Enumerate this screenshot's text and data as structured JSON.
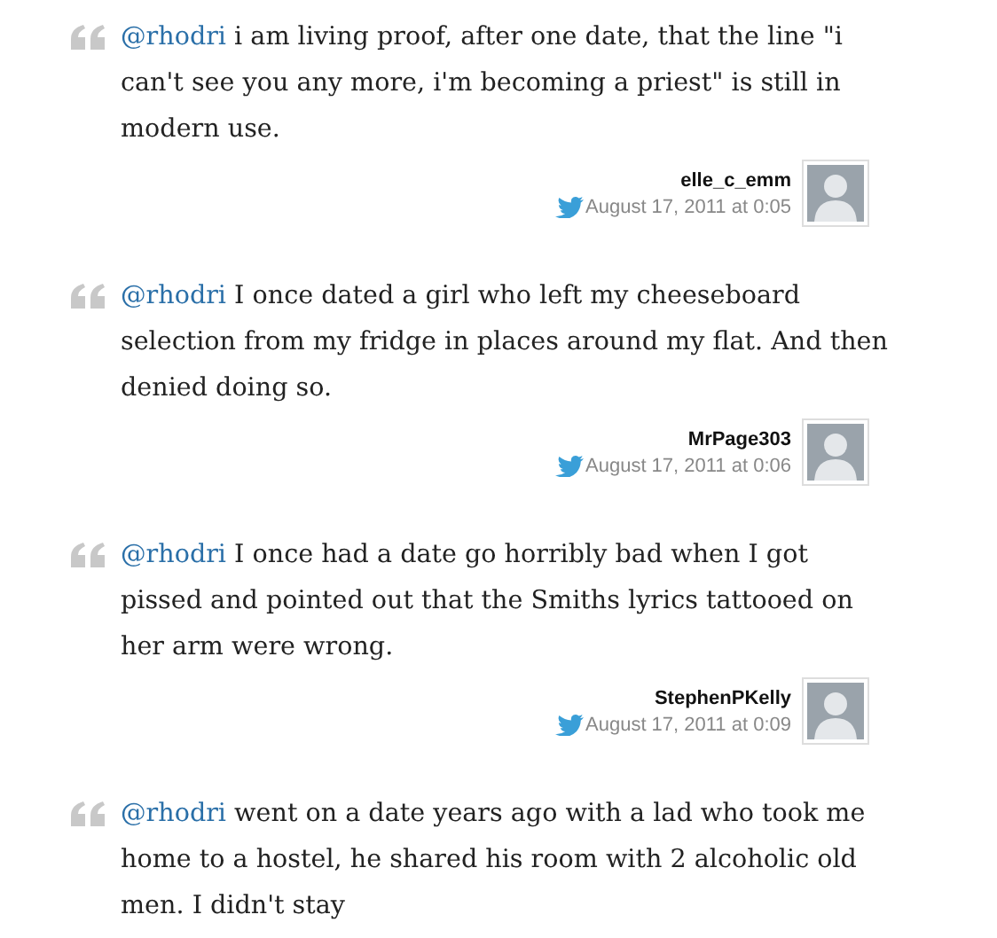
{
  "tweets": [
    {
      "mention": "@rhodri",
      "text": " i am living proof, after one date, that the line \"i can't see you any more, i'm becoming a priest\" is still in modern use.",
      "user": "elle_c_emm",
      "date": "August 17, 2011 at 0:05"
    },
    {
      "mention": "@rhodri",
      "text": " I once dated a girl who left my cheeseboard selection from my fridge in places around my flat. And then denied doing so.",
      "user": "MrPage303",
      "date": "August 17, 2011 at 0:06"
    },
    {
      "mention": "@rhodri",
      "text": " I once had a date go horribly bad when I got pissed and pointed out that the Smiths lyrics tattooed on her arm were wrong.",
      "user": "StephenPKelly",
      "date": "August 17, 2011 at 0:09"
    },
    {
      "mention": "@rhodri",
      "text": " went on a date years ago with a lad who took me home to a hostel, he shared his room with 2 alcoholic old men. I didn't stay"
    }
  ]
}
